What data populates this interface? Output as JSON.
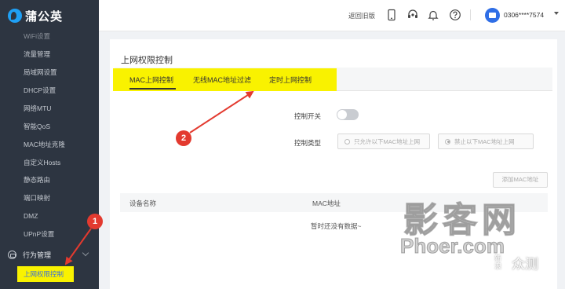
{
  "app": {
    "logo_text": "蒲公英"
  },
  "sidebar": {
    "partial_item": "WiFi设置",
    "items": [
      {
        "label": "流量管理"
      },
      {
        "label": "局域网设置"
      },
      {
        "label": "DHCP设置"
      },
      {
        "label": "网络MTU"
      },
      {
        "label": "智能QoS"
      },
      {
        "label": "MAC地址克隆"
      },
      {
        "label": "自定义Hosts"
      },
      {
        "label": "静态路由"
      },
      {
        "label": "端口映射"
      },
      {
        "label": "DMZ"
      },
      {
        "label": "UPnP设置"
      }
    ],
    "group_label": "行为管理",
    "active_item": "上网权限控制"
  },
  "header": {
    "old_version_link": "返回旧版",
    "icons": [
      "mobile-icon",
      "headset-icon",
      "bell-icon",
      "help-icon"
    ],
    "user_account": "0306****7574"
  },
  "page": {
    "title": "上网权限控制",
    "tabs": [
      {
        "label": "MAC上网控制",
        "active": true
      },
      {
        "label": "无线MAC地址过滤",
        "active": false
      },
      {
        "label": "定时上网控制",
        "active": false
      }
    ],
    "control_switch_label": "控制开关",
    "control_switch_on": false,
    "control_type_label": "控制类型",
    "control_type_options": [
      {
        "label": "只允许以下MAC地址上网",
        "selected": false
      },
      {
        "label": "禁止以下MAC地址上网",
        "selected": true
      }
    ],
    "add_button": "添加MAC地址",
    "table": {
      "columns": [
        "设备名称",
        "MAC地址"
      ],
      "empty_text": "暂时还没有数据~"
    }
  },
  "annotations": {
    "badge_1": "1",
    "badge_2": "2",
    "highlight_color": "#f9f200",
    "arrow_color": "#e33a2f"
  },
  "watermark": {
    "line1": "影客网",
    "line2": "Phoer.com",
    "corner_small": "新浪",
    "corner_large": "众测"
  }
}
